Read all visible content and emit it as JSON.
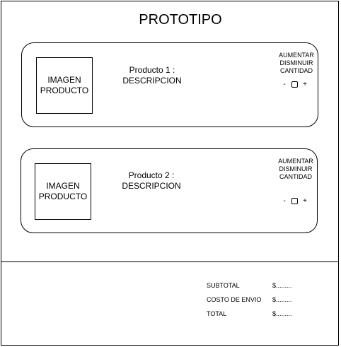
{
  "title": "PROTOTIPO",
  "products": [
    {
      "image_label": "IMAGEN\nPRODUCTO",
      "name": "Producto 1 :",
      "description": "DESCRIPCION",
      "qty_line1": "AUMENTAR",
      "qty_line2": "DISMINUIR",
      "qty_line3": "CANTIDAD",
      "minus": "-",
      "plus": "+"
    },
    {
      "image_label": "IMAGEN\nPRODUCTO",
      "name": "Producto 2 :",
      "description": "DESCRIPCION",
      "qty_line1": "AUMENTAR",
      "qty_line2": "DISMINUIR",
      "qty_line3": "CANTIDAD",
      "minus": "-",
      "plus": "+"
    }
  ],
  "summary": {
    "subtotal_label": "SUBTOTAL",
    "subtotal_value": "$.........",
    "shipping_label": "COSTO DE ENVIO",
    "shipping_value": "$.........",
    "total_label": "TOTAL",
    "total_value": "$........."
  }
}
